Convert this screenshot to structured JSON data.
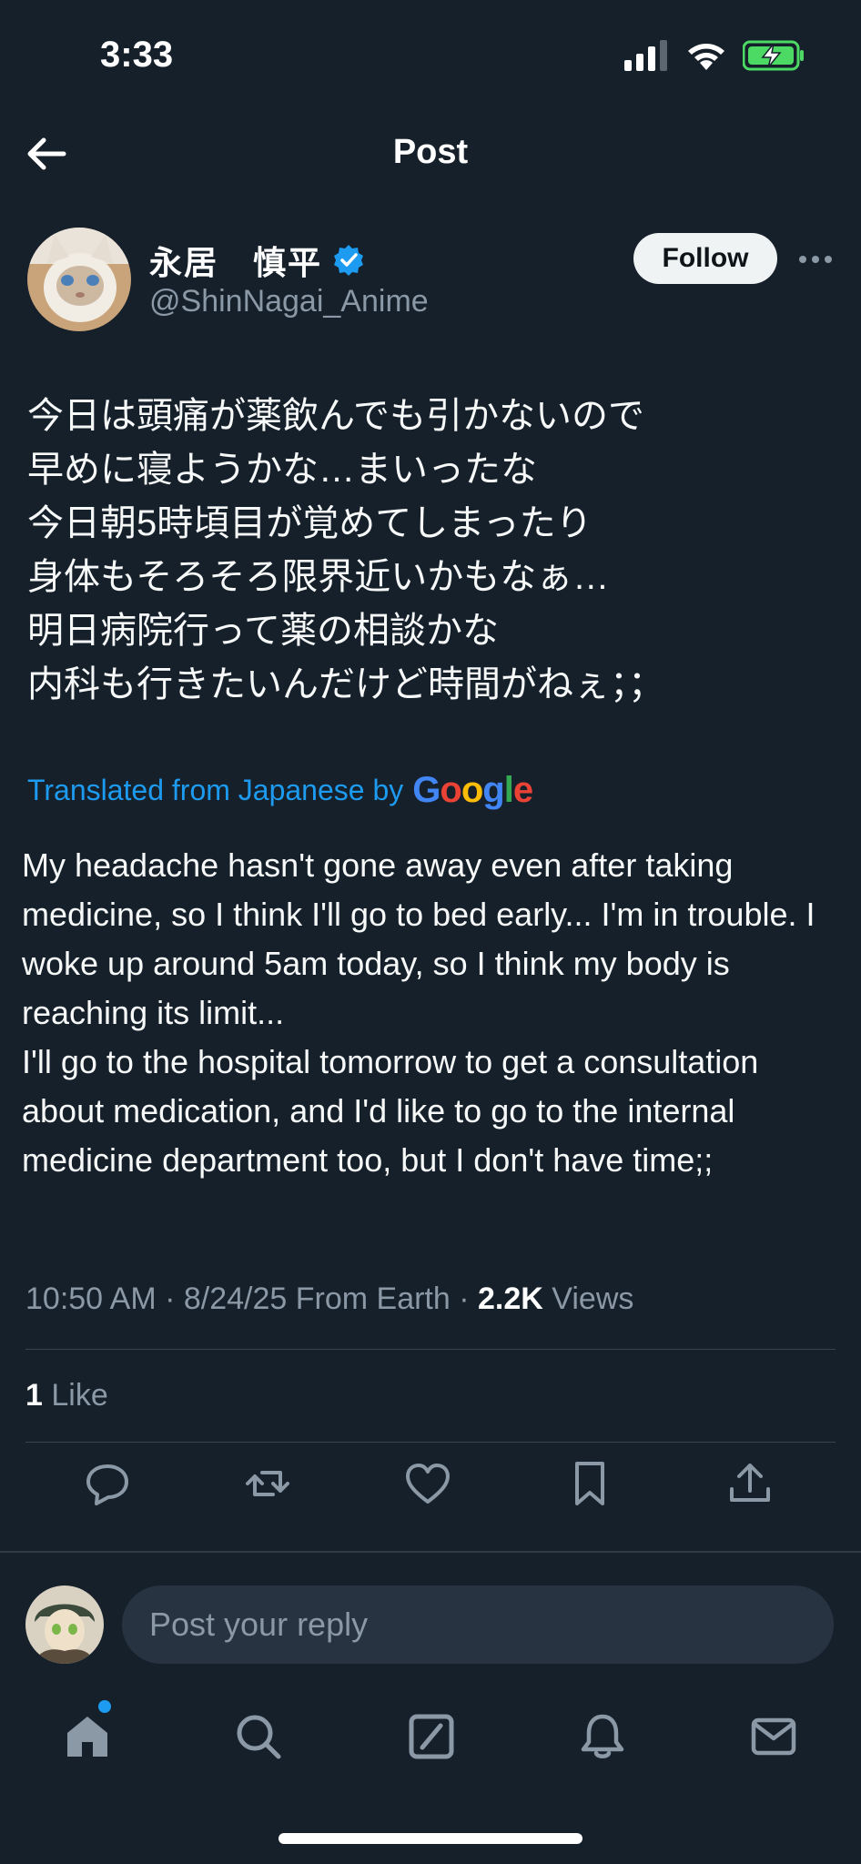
{
  "status_bar": {
    "time": "3:33"
  },
  "header": {
    "title": "Post"
  },
  "author": {
    "name": "永居　慎平",
    "handle": "@ShinNagai_Anime",
    "follow_label": "Follow"
  },
  "post": {
    "original_lines": [
      "今日は頭痛が薬飲んでも引かないので",
      "早めに寝ようかな…まいったな",
      "今日朝5時頃目が覚めてしまったり",
      "身体もそろそろ限界近いかもなぁ…",
      "明日病院行って薬の相談かな",
      "内科も行きたいんだけど時間がねぇ；；"
    ],
    "translated_label": "Translated from Japanese by",
    "translator": "Google",
    "translation": "My headache hasn't gone away even after taking medicine, so I think I'll go to bed early... I'm in trouble. I woke up around 5am today, so I think my body is reaching its limit...\nI'll go to the hospital tomorrow to get a consultation about medication, and I'd like to go to the internal medicine department too, but I don't have time;;",
    "timestamp": "10:50 AM · 8/24/25 From Earth · ",
    "views_count": "2.2K",
    "views_label": " Views",
    "likes_count": "1",
    "likes_label": " Like"
  },
  "actions": [
    "reply-icon",
    "repost-icon",
    "like-icon",
    "bookmark-icon",
    "share-icon"
  ],
  "reply": {
    "placeholder": "Post your reply"
  },
  "tab_bar": [
    "home-icon",
    "search-icon",
    "grok-icon",
    "notifications-icon",
    "messages-icon"
  ],
  "colors": {
    "background": "#15202b",
    "accent": "#1d9bf0",
    "muted": "#8b98a5"
  }
}
